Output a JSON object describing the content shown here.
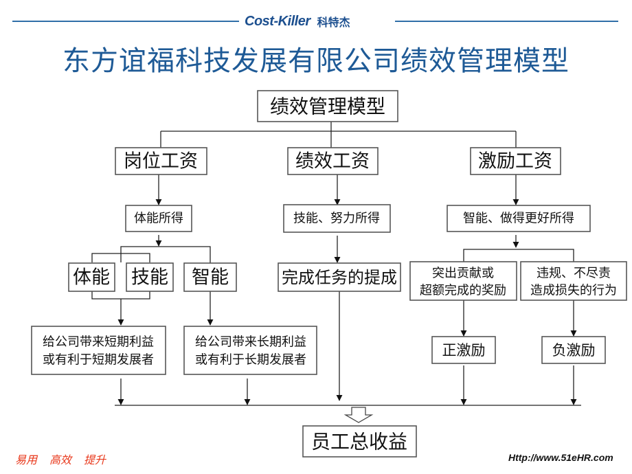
{
  "header": {
    "brand_en": "Cost-Killer",
    "brand_cn": "科特杰",
    "accent_color": "#1e5a96"
  },
  "title": "东方谊福科技发展有限公司绩效管理模型",
  "diagram": {
    "root": "绩效管理模型",
    "level1": [
      "岗位工资",
      "绩效工资",
      "激励工资"
    ],
    "level2": [
      "体能所得",
      "技能、努力所得",
      "智能、做得更好所得"
    ],
    "abilities": [
      "体能",
      "技能",
      "智能"
    ],
    "task_commission": "完成任务的提成",
    "incentive_conditions": [
      [
        "突出贡献或",
        "超额完成的奖励"
      ],
      [
        "违规、不尽责",
        "造成损失的行为"
      ]
    ],
    "benefits": [
      [
        "给公司带来短期利益",
        "或有利于短期发展者"
      ],
      [
        "给公司带来长期利益",
        "或有利于长期发展者"
      ]
    ],
    "incentives": [
      "正激励",
      "负激励"
    ],
    "result": "员工总收益"
  },
  "footer": {
    "slogans": [
      "易用",
      "高效",
      "提升"
    ],
    "url": "Http://www.51eHR.com",
    "slogan_color": "#e8371a"
  }
}
